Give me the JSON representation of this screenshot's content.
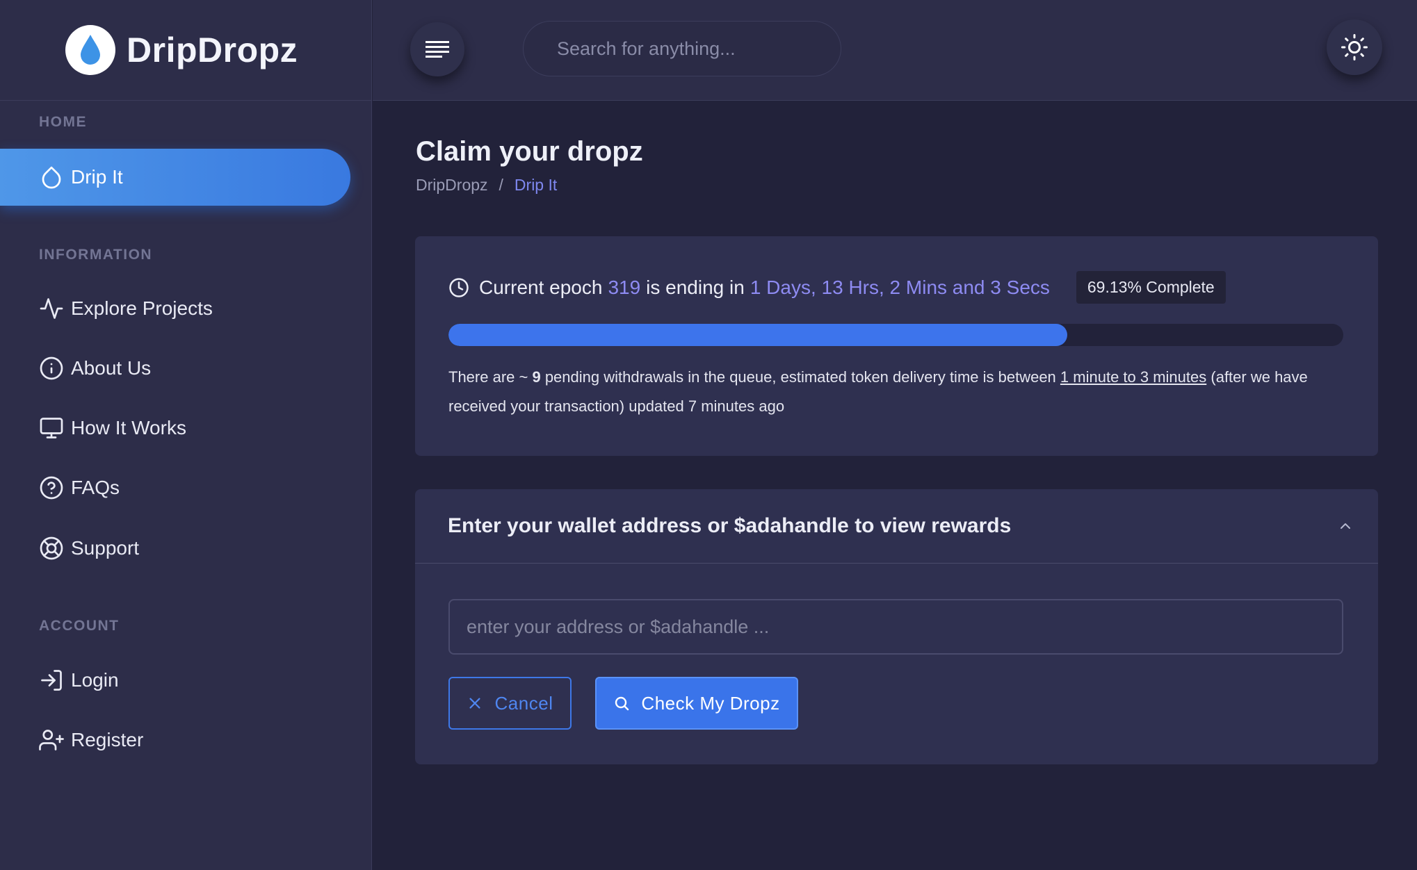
{
  "brand": {
    "name": "DripDropz",
    "logo_icon": "water-drop-icon"
  },
  "sidebar": {
    "sections": {
      "home": "HOME",
      "information": "INFORMATION",
      "account": "ACCOUNT"
    },
    "items": [
      {
        "label": "Drip It",
        "icon": "droplet-icon",
        "active": true
      },
      {
        "label": "Explore Projects",
        "icon": "activity-icon"
      },
      {
        "label": "About Us",
        "icon": "info-icon"
      },
      {
        "label": "How It Works",
        "icon": "monitor-icon"
      },
      {
        "label": "FAQs",
        "icon": "help-circle-icon"
      },
      {
        "label": "Support",
        "icon": "life-buoy-icon"
      },
      {
        "label": "Login",
        "icon": "log-in-icon"
      },
      {
        "label": "Register",
        "icon": "user-plus-icon"
      }
    ]
  },
  "topbar": {
    "menu_icon": "menu-icon",
    "search_placeholder": "Search for anything...",
    "theme_icon": "sun-icon"
  },
  "page": {
    "title": "Claim your dropz",
    "breadcrumb": {
      "root": "DripDropz",
      "separator": "/",
      "current": "Drip It"
    }
  },
  "epoch": {
    "prefix": "Current epoch",
    "number": "319",
    "middle": "is ending in",
    "remaining": "1 Days, 13 Hrs, 2 Mins and 3 Secs",
    "complete_label": "69.13% Complete",
    "progress_percent": 69.13,
    "queue": {
      "part1": "There are ~ ",
      "count": "9",
      "part2": " pending withdrawals in the queue, estimated token delivery time is between ",
      "link": "1 minute to 3 minutes",
      "part3": " (after we have received your transaction) updated 7 minutes ago"
    }
  },
  "wallet": {
    "title": "Enter your wallet address or $adahandle to view rewards",
    "input_placeholder": "enter your address or $adahandle ...",
    "cancel_label": "Cancel",
    "check_label": "Check My Dropz"
  },
  "colors": {
    "accent": "#3d74ec",
    "highlight": "#8e8bf2",
    "background": "#22223a",
    "panel": "#2d2d49"
  }
}
